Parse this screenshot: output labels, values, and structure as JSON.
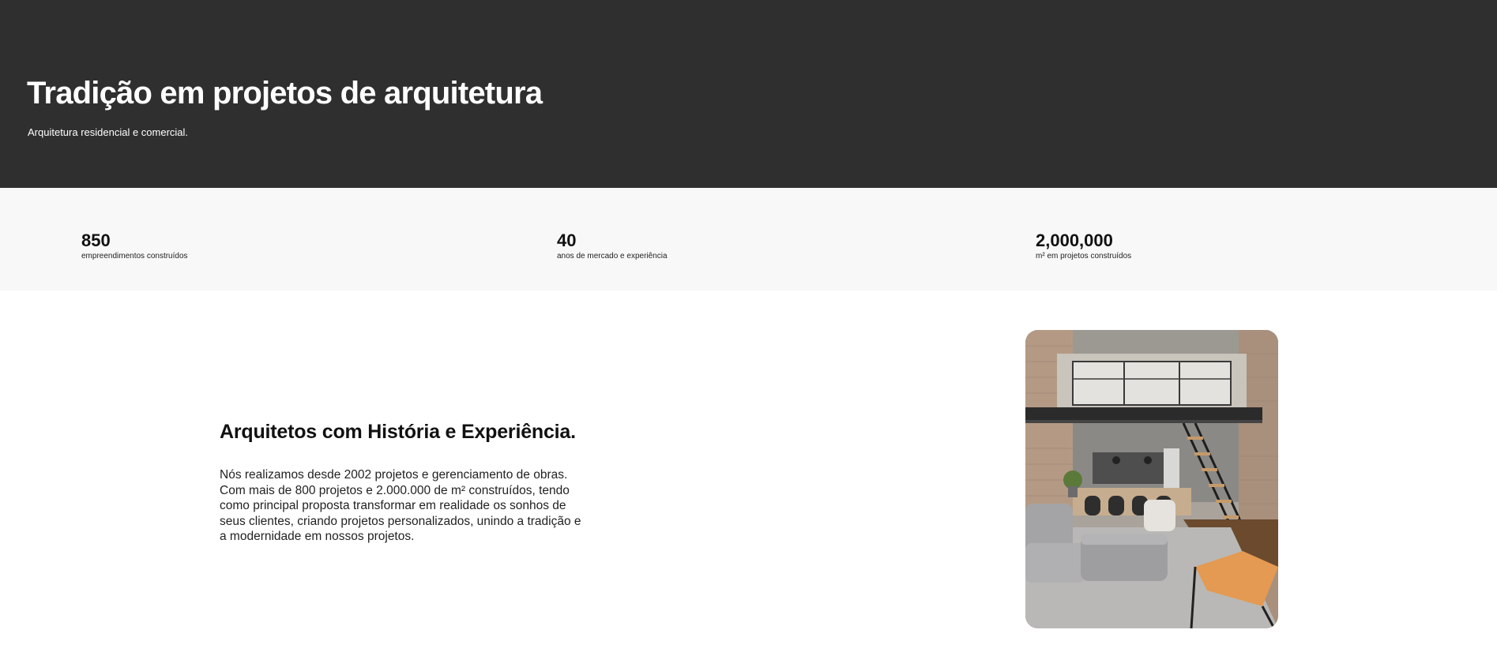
{
  "hero": {
    "title": "Tradição em projetos de arquitetura",
    "subtitle": "Arquitetura residencial e comercial."
  },
  "stats": [
    {
      "value": "850",
      "label": "empreendimentos construídos"
    },
    {
      "value": "40",
      "label": "anos de mercado e experiência"
    },
    {
      "value": "2,000,000",
      "label": "m² em projetos construídos"
    }
  ],
  "about": {
    "title": "Arquitetos com História e Experiência.",
    "text": "Nós realizamos desde 2002 projetos e gerenciamento de obras. Com mais de 800 projetos e 2.000.000 de m² construídos, tendo como principal proposta transformar em realidade os sonhos de seus clientes, criando projetos personalizados, unindo a tradição e a modernidade em nossos projetos."
  },
  "colors": {
    "hero_bg": "#2f2f2f",
    "stats_bg": "#f8f8f8",
    "page_bg": "#ffffff",
    "text_dark": "#111111"
  }
}
